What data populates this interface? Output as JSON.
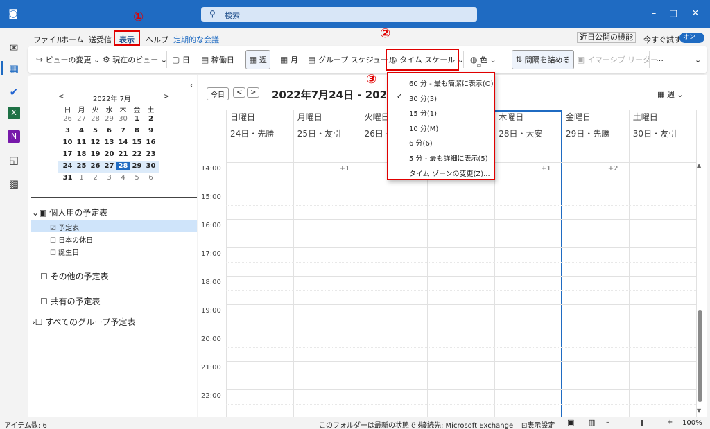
{
  "window": {
    "search_placeholder": "検索",
    "min": "–",
    "max": "□",
    "close": "✕"
  },
  "menu": {
    "file": "ファイル",
    "home": "ホーム",
    "sendrecv": "送受信",
    "view": "表示",
    "help": "ヘルプ",
    "meeting": "定期的な会議",
    "coming": "近日公開の機能",
    "try_now": "今すぐ試す",
    "toggle": "オン"
  },
  "ribbon": {
    "change_view": "ビューの変更",
    "current_view": "現在のビュー",
    "day": "日",
    "workweek": "稼働日",
    "week": "週",
    "month": "月",
    "group": "グループ スケジュール",
    "timescale": "タイム スケール",
    "color": "色",
    "condense": "間隔を詰める",
    "reader": "イマーシブ リーダー",
    "more": "…"
  },
  "annotations": {
    "a1": "①",
    "a2": "②",
    "a3": "③"
  },
  "minical": {
    "title": "2022年 7月",
    "prev": "<",
    "next": ">",
    "weekdays": [
      "日",
      "月",
      "火",
      "水",
      "木",
      "金",
      "土"
    ],
    "rows": [
      [
        "26",
        "27",
        "28",
        "29",
        "30",
        "1",
        "2"
      ],
      [
        "3",
        "4",
        "5",
        "6",
        "7",
        "8",
        "9"
      ],
      [
        "10",
        "11",
        "12",
        "13",
        "14",
        "15",
        "16"
      ],
      [
        "17",
        "18",
        "19",
        "20",
        "21",
        "22",
        "23"
      ],
      [
        "24",
        "25",
        "26",
        "27",
        "28",
        "29",
        "30"
      ],
      [
        "31",
        "1",
        "2",
        "3",
        "4",
        "5",
        "6"
      ]
    ]
  },
  "folders": {
    "personal": "個人用の予定表",
    "calendar": "予定表",
    "jp_holidays": "日本の休日",
    "birthdays": "誕生日",
    "other": "その他の予定表",
    "shared": "共有の予定表",
    "group": "すべてのグループ予定表"
  },
  "calendar": {
    "today": "今日",
    "prev": "<",
    "next": ">",
    "range": "2022年7月24日 - 202",
    "view_label": "週",
    "days": [
      {
        "name": "日曜日",
        "date": "24日・先勝"
      },
      {
        "name": "月曜日",
        "date": "25日・友引"
      },
      {
        "name": "火曜日",
        "date": "26日・"
      },
      {
        "name": "",
        "date": ""
      },
      {
        "name": "木曜日",
        "date": "28日・大安"
      },
      {
        "name": "金曜日",
        "date": "29日・先勝"
      },
      {
        "name": "土曜日",
        "date": "30日・友引"
      }
    ],
    "more_tags": [
      "+1",
      "+1",
      "+2"
    ],
    "times": [
      "14:00",
      "15:00",
      "16:00",
      "17:00",
      "18:00",
      "19:00",
      "20:00",
      "21:00",
      "22:00"
    ]
  },
  "timescale_menu": {
    "items": [
      {
        "label": "60 分 - 最も簡潔に表示(O)",
        "checked": false
      },
      {
        "label": "30 分(3)",
        "checked": true
      },
      {
        "label": "15 分(1)",
        "checked": false
      },
      {
        "label": "10 分(M)",
        "checked": false
      },
      {
        "label": "6 分(6)",
        "checked": false
      },
      {
        "label": "5 分 - 最も詳細に表示(5)",
        "checked": false
      }
    ],
    "change_tz": "タイム ゾーンの変更(Z)...",
    "check": "✓"
  },
  "status": {
    "items": "アイテム数: 6",
    "folder": "このフォルダーは最新の状態です。",
    "conn": "接続先: Microsoft Exchange",
    "display": "表示設定",
    "zoom": "100%",
    "minus": "–",
    "plus": "+"
  },
  "colors": {
    "brand": "#1f6bc2",
    "accent": "#e00000",
    "today": "#1f6bc2"
  }
}
